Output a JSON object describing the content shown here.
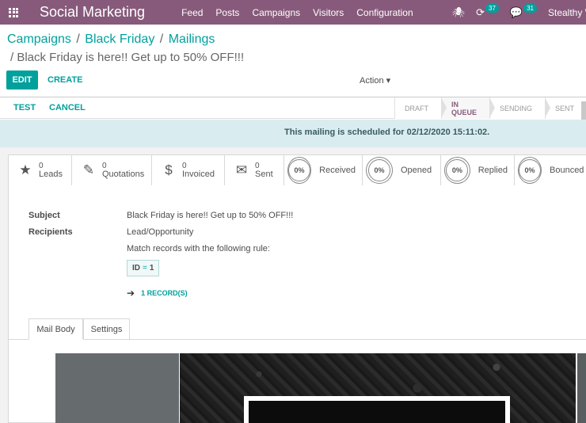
{
  "navbar": {
    "brand": "Social Marketing",
    "menu": [
      "Feed",
      "Posts",
      "Campaigns",
      "Visitors",
      "Configuration"
    ],
    "activity_count": "37",
    "messages_count": "31",
    "user": "Stealthy Wood"
  },
  "breadcrumb": {
    "items": [
      "Campaigns",
      "Black Friday",
      "Mailings"
    ],
    "active": "/ Black Friday is here!! Get up to 50% OFF!!!"
  },
  "controls": {
    "edit": "EDIT",
    "create": "CREATE",
    "action": "Action ▾"
  },
  "statusbar": {
    "test": "TEST",
    "cancel": "CANCEL",
    "stages": [
      "DRAFT",
      "IN QUEUE",
      "SENDING",
      "SENT"
    ],
    "active_stage": "IN QUEUE"
  },
  "alert": "This mailing is scheduled for 02/12/2020 15:11:02.",
  "stats": [
    {
      "icon": "star-icon",
      "num": "0",
      "label": "Leads"
    },
    {
      "icon": "pencil-icon",
      "num": "0",
      "label": "Quotations"
    },
    {
      "icon": "dollar-icon",
      "num": "0",
      "label": "Invoiced"
    },
    {
      "icon": "envelope-icon",
      "num": "0",
      "label": "Sent"
    }
  ],
  "percent_stats": [
    {
      "value": "0%",
      "label": "Received"
    },
    {
      "value": "0%",
      "label": "Opened"
    },
    {
      "value": "0%",
      "label": "Replied"
    },
    {
      "value": "0%",
      "label": "Bounced"
    }
  ],
  "fields": {
    "subject_label": "Subject",
    "subject_value": "Black Friday is here!! Get up to 50% OFF!!!",
    "recipients_label": "Recipients",
    "recipients_value": "Lead/Opportunity",
    "rule_text": "Match records with the following rule:",
    "domain_field": "ID",
    "domain_op": "=",
    "domain_value": "1",
    "records_link": "1 RECORD(S)"
  },
  "tabs": [
    "Mail Body",
    "Settings"
  ]
}
